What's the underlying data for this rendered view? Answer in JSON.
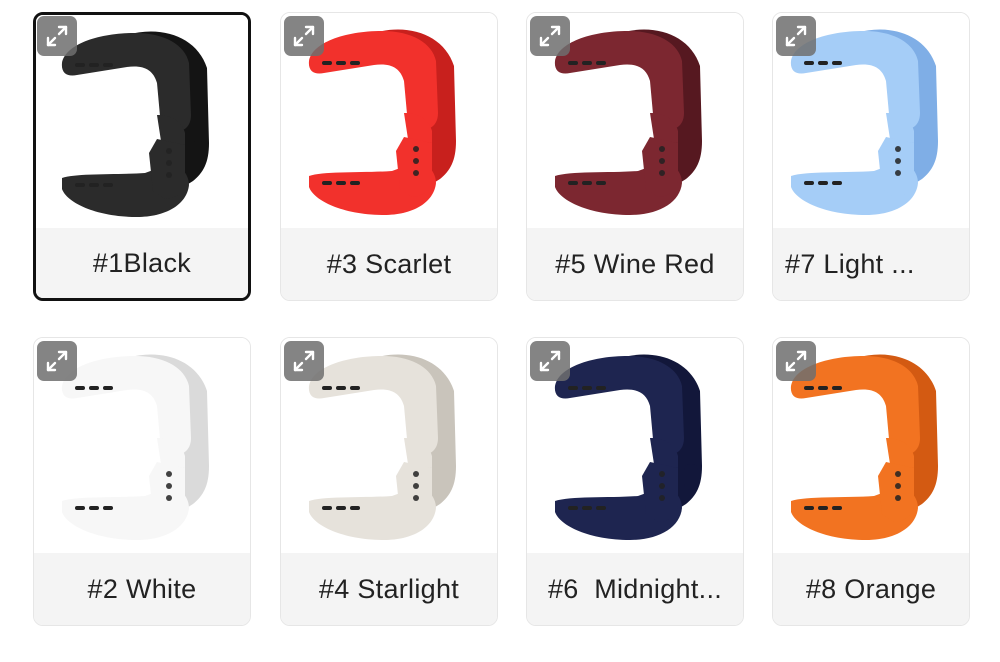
{
  "variants": [
    {
      "label": "#1Black",
      "color": "#2b2b2b",
      "shade": "#141414",
      "selected": true
    },
    {
      "label": "#3 Scarlet",
      "color": "#f2312c",
      "shade": "#c8201d",
      "selected": false
    },
    {
      "label": "#5 Wine Red",
      "color": "#7c2730",
      "shade": "#561820",
      "selected": false
    },
    {
      "label": "#7 Light ...",
      "color": "#a5cdf7",
      "shade": "#7faee6",
      "selected": false
    },
    {
      "label": "#2 White",
      "color": "#f7f7f7",
      "shade": "#dadada",
      "selected": false
    },
    {
      "label": "#4 Starlight",
      "color": "#e6e2db",
      "shade": "#c9c4bb",
      "selected": false
    },
    {
      "label": "#6  Midnight...",
      "color": "#1e2550",
      "shade": "#12173a",
      "selected": false
    },
    {
      "label": "#8 Orange",
      "color": "#f27321",
      "shade": "#d35a12",
      "selected": false
    }
  ],
  "icons": {
    "expand": "expand-icon"
  }
}
